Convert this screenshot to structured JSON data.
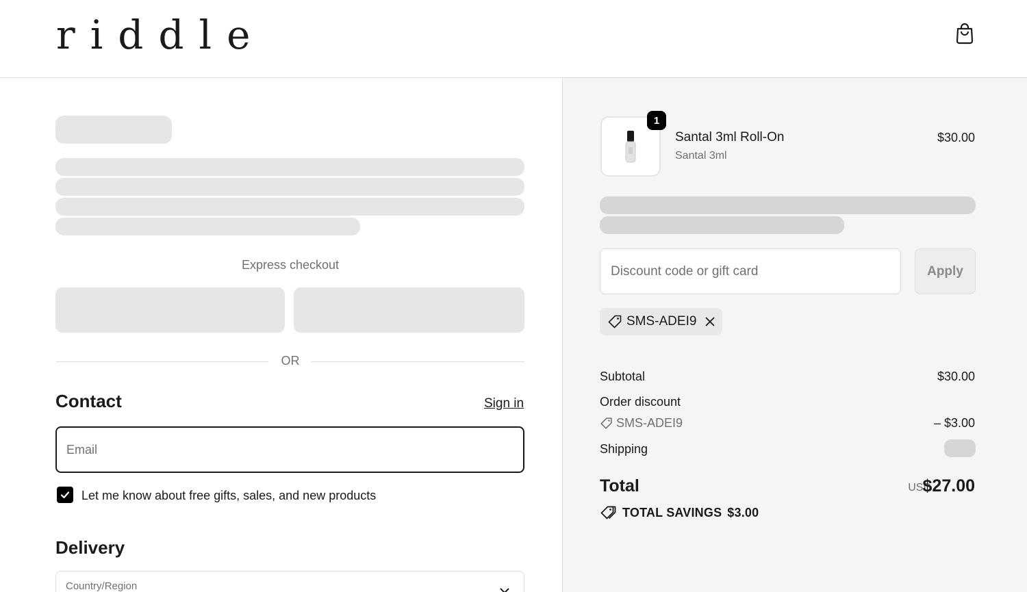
{
  "header": {
    "logo": "riddle",
    "cart_icon": "shopping-bag-icon"
  },
  "checkout": {
    "express_label": "Express checkout",
    "or_label": "OR",
    "contact": {
      "title": "Contact",
      "sign_in_label": "Sign in",
      "email_placeholder": "Email",
      "marketing_opt_in_label": "Let me know about free gifts, sales, and new products",
      "marketing_opt_in_checked": true
    },
    "delivery": {
      "title": "Delivery",
      "country_label": "Country/Region"
    }
  },
  "summary": {
    "item": {
      "name": "Santal 3ml Roll-On",
      "variant": "Santal 3ml",
      "price": "$30.00",
      "quantity": "1"
    },
    "discount": {
      "placeholder": "Discount code or gift card",
      "apply_label": "Apply",
      "applied_code": "SMS-ADEI9"
    },
    "subtotal_label": "Subtotal",
    "subtotal_value": "$30.00",
    "order_discount_label": "Order discount",
    "order_discount_code": "SMS-ADEI9",
    "order_discount_value": "– $3.00",
    "shipping_label": "Shipping",
    "total_label": "Total",
    "total_currency": "USD",
    "total_value": "$27.00",
    "savings_label": "TOTAL SAVINGS",
    "savings_value": "$3.00"
  },
  "colors": {
    "accent": "#000000",
    "summary_bg": "#f5f5f5",
    "skeleton": "#e6e6e6"
  }
}
